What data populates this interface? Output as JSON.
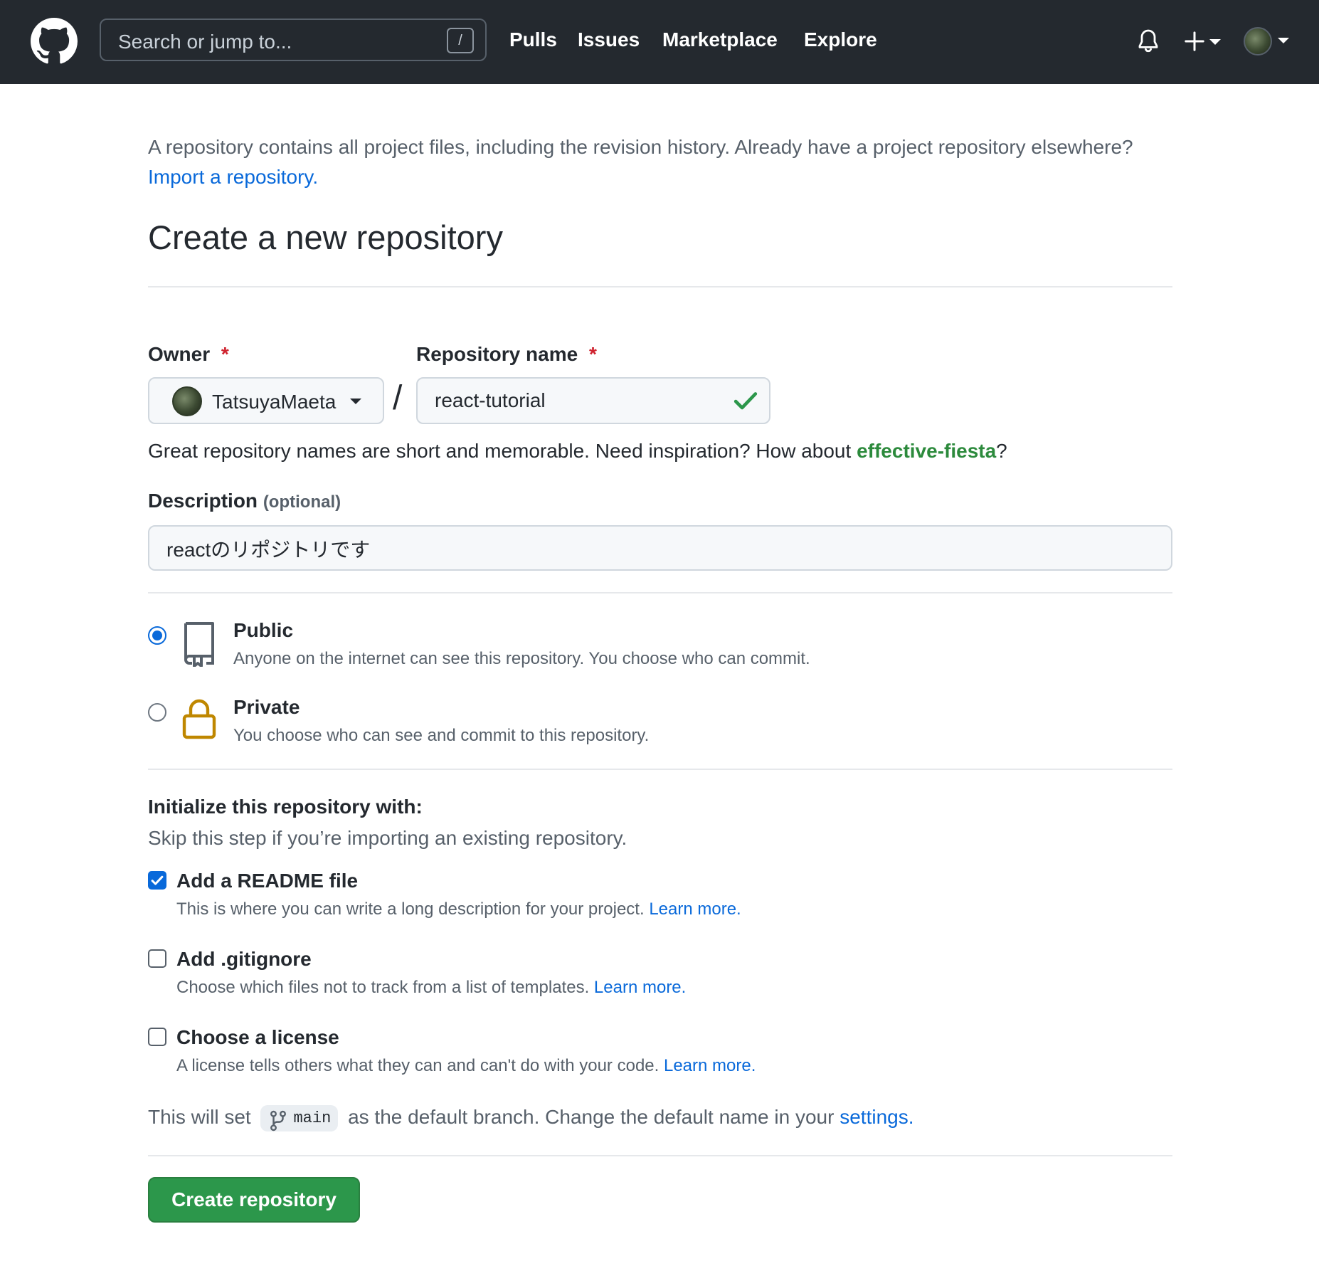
{
  "header": {
    "search_placeholder": "Search or jump to...",
    "search_shortcut": "/",
    "nav": [
      "Pulls",
      "Issues",
      "Marketplace",
      "Explore"
    ],
    "icons": [
      "github-logo-icon",
      "bell-icon",
      "plus-icon",
      "avatar"
    ]
  },
  "intro": {
    "text": "A repository contains all project files, including the revision history. Already have a project repository elsewhere?",
    "link": "Import a repository."
  },
  "page_title": "Create a new repository",
  "owner": {
    "label": "Owner",
    "required": "*",
    "value": "TatsuyaMaeta"
  },
  "separator": "/",
  "repo_name": {
    "label": "Repository name",
    "required": "*",
    "value": "react-tutorial"
  },
  "hint": {
    "text": "Great repository names are short and memorable. Need inspiration? How about",
    "suggestion": "effective-fiesta",
    "end": "?"
  },
  "description": {
    "label": "Description",
    "optional": "(optional)",
    "value": "reactのリポジトリです"
  },
  "visibility": {
    "public": {
      "title": "Public",
      "desc": "Anyone on the internet can see this repository. You choose who can commit."
    },
    "private": {
      "title": "Private",
      "desc": "You choose who can see and commit to this repository."
    },
    "selected": "public"
  },
  "init": {
    "title": "Initialize this repository with:",
    "subtitle": "Skip this step if you’re importing an existing repository.",
    "options": [
      {
        "title": "Add a README file",
        "desc": "This is where you can write a long description for your project.",
        "link": "Learn more.",
        "checked": true
      },
      {
        "title": "Add .gitignore",
        "desc": "Choose which files not to track from a list of templates.",
        "link": "Learn more.",
        "checked": false
      },
      {
        "title": "Choose a license",
        "desc": "A license tells others what they can and can't do with your code.",
        "link": "Learn more.",
        "checked": false
      }
    ]
  },
  "branch": {
    "prefix": "This will set",
    "name": "main",
    "suffix": "as the default branch. Change the default name in your",
    "link": "settings",
    "end": "."
  },
  "create_button": "Create repository",
  "colors": {
    "header_bg": "#24292f",
    "link": "#0969da",
    "suggestion": "#2c8a3c",
    "create_button": "#2c974b",
    "required": "#cf222e",
    "lock": "#bf8700"
  }
}
